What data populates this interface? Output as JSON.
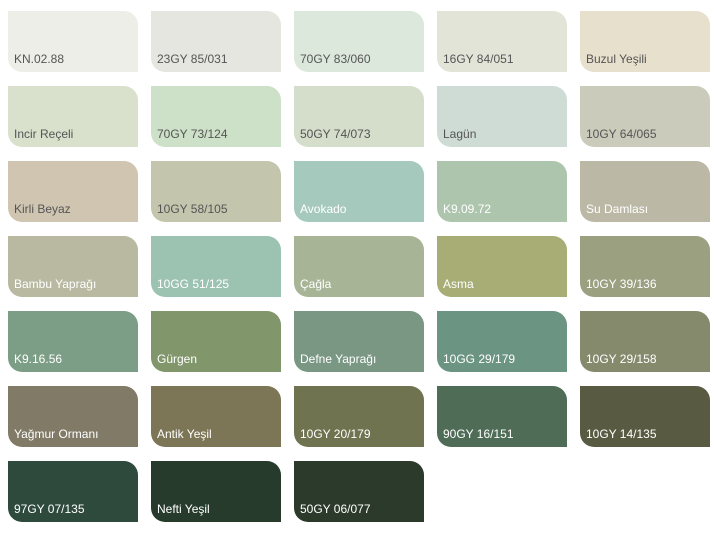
{
  "swatches": [
    {
      "name": "KN.02.88",
      "color": "#eceee7",
      "text": "#555555"
    },
    {
      "name": "23GY 85/031",
      "color": "#e5e6df",
      "text": "#555555"
    },
    {
      "name": "70GY 83/060",
      "color": "#dce8dc",
      "text": "#555555"
    },
    {
      "name": "16GY 84/051",
      "color": "#e2e4d8",
      "text": "#555555"
    },
    {
      "name": "Buzul Yeşili",
      "color": "#e6e0cc",
      "text": "#555555"
    },
    {
      "name": "Incir Reçeli",
      "color": "#d9e1cd",
      "text": "#555555"
    },
    {
      "name": "70GY 73/124",
      "color": "#cde0c8",
      "text": "#555555"
    },
    {
      "name": "50GY 74/073",
      "color": "#d5ddcb",
      "text": "#555555"
    },
    {
      "name": "Lagün",
      "color": "#cfdbd5",
      "text": "#555555"
    },
    {
      "name": "10GY 64/065",
      "color": "#cacbbb",
      "text": "#555555"
    },
    {
      "name": "Kirli Beyaz",
      "color": "#cfc5b1",
      "text": "#555555"
    },
    {
      "name": "10GY 58/105",
      "color": "#c3c6ad",
      "text": "#555555"
    },
    {
      "name": "Avokado",
      "color": "#a6c9bd",
      "text": "#ffffff"
    },
    {
      "name": "K9.09.72",
      "color": "#aec5ad",
      "text": "#ffffff"
    },
    {
      "name": "Su Damlası",
      "color": "#bcb8a6",
      "text": "#ffffff"
    },
    {
      "name": "Bambu Yaprağı",
      "color": "#b9b8a1",
      "text": "#ffffff"
    },
    {
      "name": "10GG 51/125",
      "color": "#9cc2b2",
      "text": "#ffffff"
    },
    {
      "name": "Çağla",
      "color": "#a7b596",
      "text": "#ffffff"
    },
    {
      "name": "Asma",
      "color": "#a7ad75",
      "text": "#ffffff"
    },
    {
      "name": "10GY 39/136",
      "color": "#9aa080",
      "text": "#ffffff"
    },
    {
      "name": "K9.16.56",
      "color": "#7d9e86",
      "text": "#ffffff"
    },
    {
      "name": "Gürgen",
      "color": "#81966a",
      "text": "#ffffff"
    },
    {
      "name": "Defne Yaprağı",
      "color": "#7a9784",
      "text": "#ffffff"
    },
    {
      "name": "10GG 29/179",
      "color": "#6c9483",
      "text": "#ffffff"
    },
    {
      "name": "10GY 29/158",
      "color": "#858a6c",
      "text": "#ffffff"
    },
    {
      "name": "Yağmur Ormanı",
      "color": "#807a66",
      "text": "#ffffff"
    },
    {
      "name": "Antik Yeşil",
      "color": "#7c7657",
      "text": "#ffffff"
    },
    {
      "name": "10GY 20/179",
      "color": "#6f7350",
      "text": "#ffffff"
    },
    {
      "name": "90GY 16/151",
      "color": "#4f6c56",
      "text": "#ffffff"
    },
    {
      "name": "10GY 14/135",
      "color": "#585b42",
      "text": "#ffffff"
    },
    {
      "name": "97GY 07/135",
      "color": "#2d4a3d",
      "text": "#ffffff"
    },
    {
      "name": "Nefti Yeşil",
      "color": "#263b2b",
      "text": "#ffffff"
    },
    {
      "name": "50GY 06/077",
      "color": "#2c3a2b",
      "text": "#ffffff"
    }
  ]
}
